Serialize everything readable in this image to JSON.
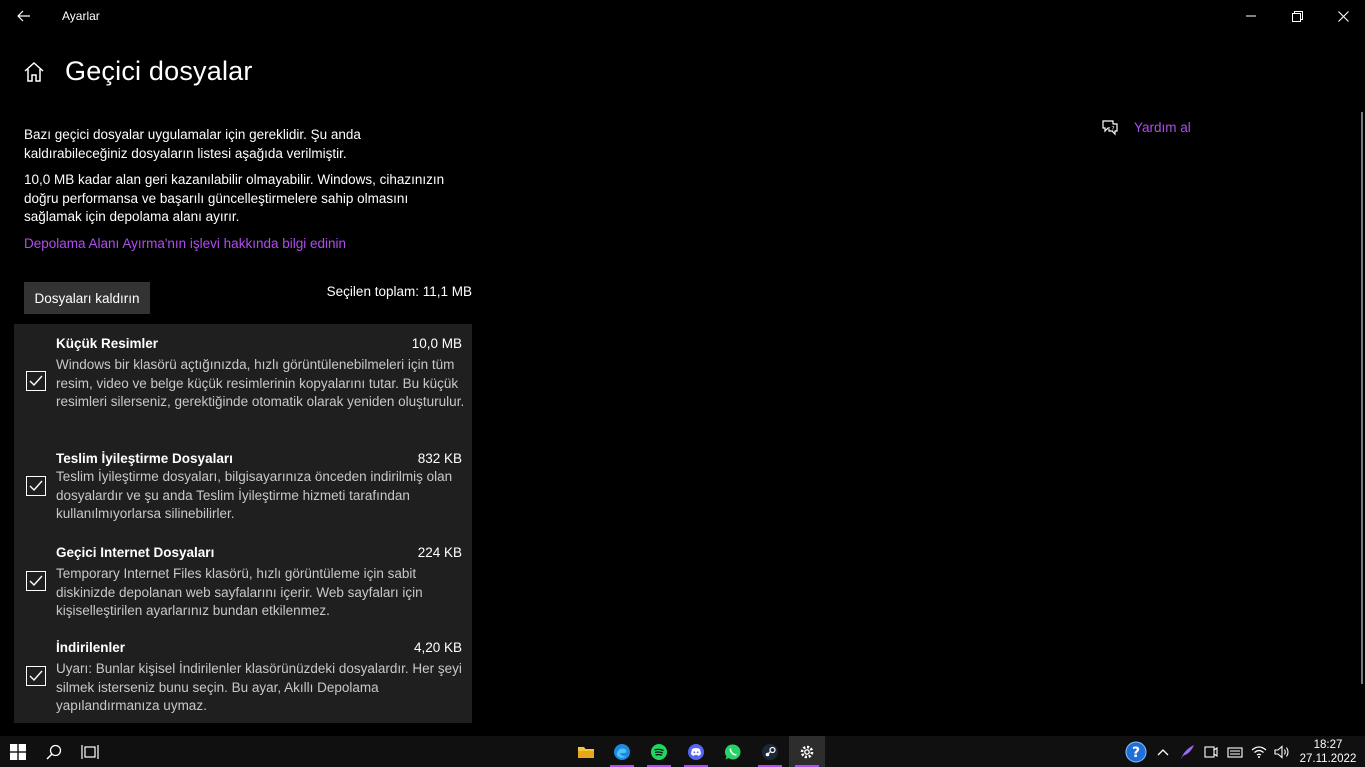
{
  "window": {
    "title": "Ayarlar"
  },
  "page": {
    "title": "Geçici dosyalar",
    "desc1": "Bazı geçici dosyalar uygulamalar için gereklidir. Şu anda kaldırabileceğiniz dosyaların listesi aşağıda verilmiştir.",
    "desc2": "10,0 MB kadar alan geri kazanılabilir olmayabilir. Windows, cihazınızın doğru performansa ve başarılı güncelleştirmelere sahip olmasını sağlamak için depolama alanı ayırır.",
    "learn_link": "Depolama Alanı Ayırma'nın işlevi hakkında bilgi edinin",
    "remove_button": "Dosyaları kaldırın",
    "total": "Seçilen toplam: 11,1 MB"
  },
  "items": [
    {
      "name": "Küçük Resimler",
      "size": "10,0 MB",
      "checked": true,
      "desc": "Windows bir klasörü açtığınızda, hızlı görüntülenebilmeleri için tüm resim, video ve belge küçük resimlerinin kopyalarını tutar. Bu küçük resimleri silerseniz, gerektiğinde otomatik olarak yeniden oluşturulur."
    },
    {
      "name": "Teslim İyileştirme Dosyaları",
      "size": "832 KB",
      "checked": true,
      "desc": "Teslim İyileştirme dosyaları, bilgisayarınıza önceden indirilmiş olan dosyalardır ve şu anda Teslim İyileştirme hizmeti tarafından kullanılmıyorlarsa silinebilirler."
    },
    {
      "name": "Geçici Internet Dosyaları",
      "size": "224 KB",
      "checked": true,
      "desc": "Temporary Internet Files klasörü, hızlı görüntüleme için sabit diskinizde depolanan web sayfalarını içerir. Web sayfaları için kişiselleştirilen ayarlarınız bundan etkilenmez."
    },
    {
      "name": "İndirilenler",
      "size": "4,20 KB",
      "checked": true,
      "desc": "Uyarı: Bunlar kişisel İndirilenler klasörünüzdeki dosyalardır. Her şeyi silmek isterseniz bunu seçin. Bu ayar, Akıllı Depolama yapılandırmanıza uymaz."
    }
  ],
  "help": {
    "label": "Yardım al"
  },
  "taskbar": {
    "time": "18:27",
    "date": "27.11.2022",
    "apps": [
      "file-explorer-icon",
      "edge-icon",
      "spotify-icon",
      "discord-icon",
      "whatsapp-icon",
      "steam-icon",
      "settings-icon"
    ]
  },
  "colors": {
    "accent": "#b04cf0",
    "panel": "#1f1f1f",
    "button": "#333333"
  }
}
